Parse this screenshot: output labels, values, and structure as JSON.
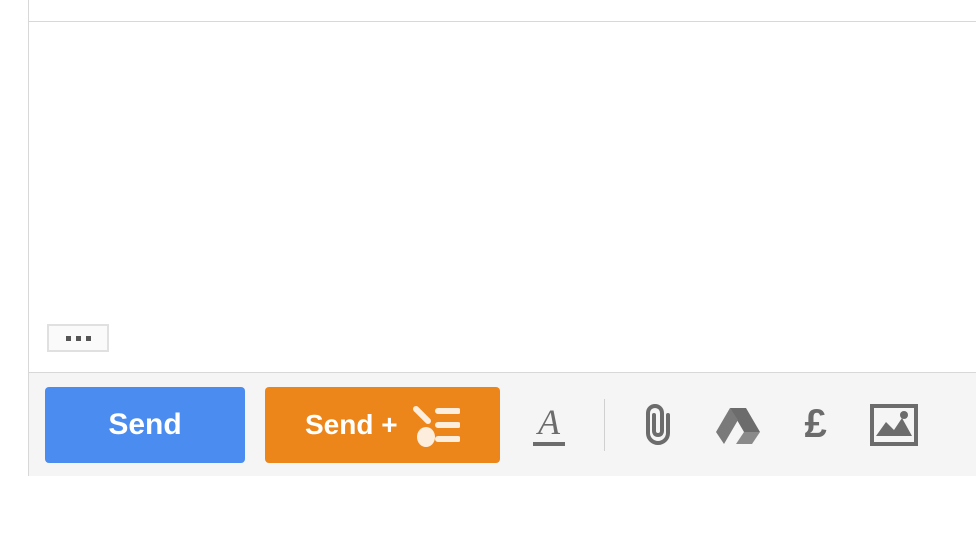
{
  "compose": {
    "body": ""
  },
  "toolbar": {
    "show_trimmed_label": "Show trimmed content",
    "send_label": "Send",
    "send_plus_label": "Send +",
    "icons": {
      "format": "format-icon",
      "attach": "attachment-icon",
      "drive": "drive-icon",
      "money": "£",
      "image": "image-icon"
    }
  },
  "colors": {
    "send_bg": "#4a8cf0",
    "send_plus_bg": "#ed861a",
    "toolbar_bg": "#f5f5f5",
    "icon_gray": "#6c6c6c"
  }
}
